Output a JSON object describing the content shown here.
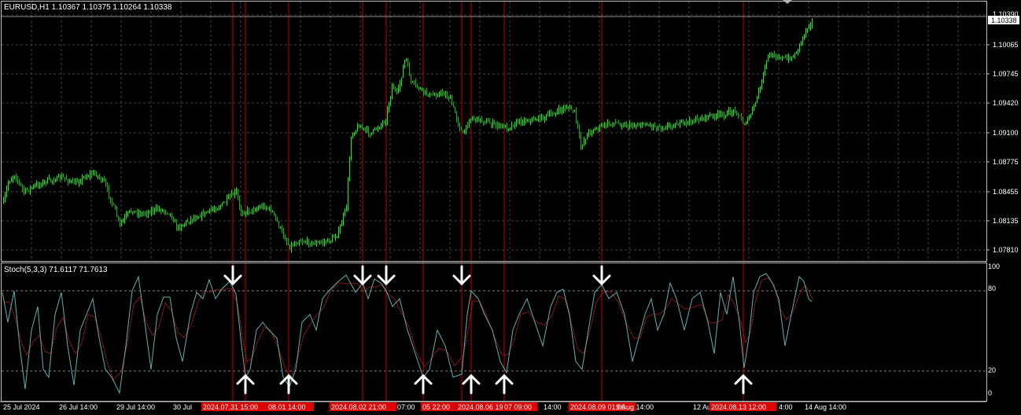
{
  "symbol_header": "EURUSD,H1  1.10367 1.10375 1.10264 1.10338",
  "current_price": "1.10338",
  "price_axis": [
    "1.10390",
    "1.10065",
    "1.09745",
    "1.09420",
    "1.09100",
    "1.08775",
    "1.08455",
    "1.08135",
    "1.07810"
  ],
  "indicator_header": "Stoch(5,3,3) 71.6117 71.7613",
  "stoch_axis": [
    "100",
    "80",
    "20",
    "0"
  ],
  "time_axis": [
    {
      "label": "25 Jul 2024",
      "highlight": false
    },
    {
      "label": "26 Jul 14:00",
      "highlight": false
    },
    {
      "label": "29 Jul 14:00",
      "highlight": false
    },
    {
      "label": "30 Jul",
      "highlight": false
    },
    {
      "label": "2024.07.31 15:00",
      "highlight": true
    },
    {
      "label": "08.01 14:00",
      "highlight": true
    },
    {
      "label": "2024.08.02 21:00",
      "highlight": true
    },
    {
      "label": "07:00",
      "highlight": false
    },
    {
      "label": "05 22:00",
      "highlight": true
    },
    {
      "label": "2024.08.06 19:00",
      "highlight": true
    },
    {
      "label": "07 09:00",
      "highlight": true
    },
    {
      "label": "14:00",
      "highlight": false
    },
    {
      "label": "2024.08.09 01:00",
      "highlight": true
    },
    {
      "label": "9 Aug 14:00",
      "highlight": false
    },
    {
      "label": "12 Aug",
      "highlight": false
    },
    {
      "label": "2024.08.13 12:00",
      "highlight": true
    },
    {
      "label": "4:00",
      "highlight": false
    },
    {
      "label": "14 Aug 14:00",
      "highlight": false
    }
  ],
  "signals": [
    {
      "dir": "down",
      "time": "2024.07.31 15:00"
    },
    {
      "dir": "up",
      "time": "2024.07.31 18:00"
    },
    {
      "dir": "up",
      "time": "2024.08.01 14:00"
    },
    {
      "dir": "down",
      "time": "2024.08.02 15:00"
    },
    {
      "dir": "down",
      "time": "2024.08.02 21:00"
    },
    {
      "dir": "up",
      "time": "2024.08.05 22:00"
    },
    {
      "dir": "down",
      "time": "2024.08.06 12:00"
    },
    {
      "dir": "up",
      "time": "2024.08.06 19:00"
    },
    {
      "dir": "up",
      "time": "2024.08.07 09:00"
    },
    {
      "dir": "down",
      "time": "2024.08.09 01:00"
    },
    {
      "dir": "up",
      "time": "2024.08.13 12:00"
    }
  ],
  "colors": {
    "background": "#000000",
    "bull": "#00ff00",
    "bear": "#00c000",
    "grid": "#404040",
    "signal_line": "#c00000",
    "stoch_main": "#5fb0b0",
    "stoch_signal": "#c02020",
    "axis_text": "#ffffff",
    "highlight_bg": "#e00000"
  }
}
